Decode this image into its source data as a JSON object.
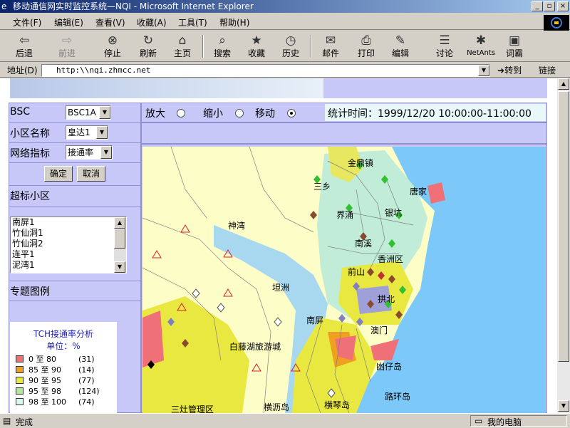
{
  "window": {
    "title": "移动通信网实时监控系统—NQI - Microsoft Internet Explorer"
  },
  "menu": [
    "文件(F)",
    "编辑(E)",
    "查看(V)",
    "收藏(A)",
    "工具(T)",
    "帮助(H)"
  ],
  "toolbar": {
    "back": "后退",
    "forward": "前进",
    "stop": "停止",
    "refresh": "刷新",
    "home": "主页",
    "search": "搜索",
    "favorites": "收藏",
    "history": "历史",
    "mail": "邮件",
    "print": "打印",
    "edit": "编辑",
    "discuss": "讨论",
    "netants": "NetAnts",
    "dict": "词霸"
  },
  "address": {
    "label": "地址(D)",
    "url": "http:\\\\nqi.zhmcc.net",
    "go": "转到",
    "links": "链接"
  },
  "form": {
    "bsc_label": "BSC",
    "bsc_value": "BSC1A",
    "cell_label": "小区名称",
    "cell_value": "皇达1",
    "metric_label": "网络指标",
    "metric_value": "接通率",
    "ok": "确定",
    "cancel": "取消",
    "over_label": "超标小区",
    "over_items": [
      "南屏1",
      "竹仙洞1",
      "竹仙洞2",
      "连平1",
      "泥湾1"
    ],
    "legend_title": "专题图例"
  },
  "mapbar": {
    "zoom_in": "放大",
    "zoom_out": "缩小",
    "move": "移动",
    "selected": "move",
    "stat_time": "统计时间：1999/12/20 10:00:00-11:00:00"
  },
  "legend": {
    "title": "TCH接通率分析",
    "unit": "单位：%",
    "rows": [
      {
        "range": "0 至 80",
        "count": "(31)",
        "color": "#f07078"
      },
      {
        "range": "85 至 90",
        "count": "(14)",
        "color": "#f0a020"
      },
      {
        "range": "90 至 95",
        "count": "(77)",
        "color": "#e8e840"
      },
      {
        "range": "95 至 98",
        "count": "(124)",
        "color": "#b0e8a0"
      },
      {
        "range": "98 至 100",
        "count": "(74)",
        "color": "#d8f8f0"
      }
    ]
  },
  "map_labels": [
    "金鼎镇",
    "三乡",
    "唐家",
    "神湾",
    "界涌",
    "银坑",
    "南溪",
    "香洲区",
    "前山",
    "坦洲",
    "拱北",
    "南屏",
    "澳门",
    "白藤湖旅游城",
    "凼仔岛",
    "路环岛",
    "三灶管理区",
    "横沥岛",
    "横琴岛"
  ],
  "status": {
    "text": "完成",
    "zone": "我的电脑"
  }
}
